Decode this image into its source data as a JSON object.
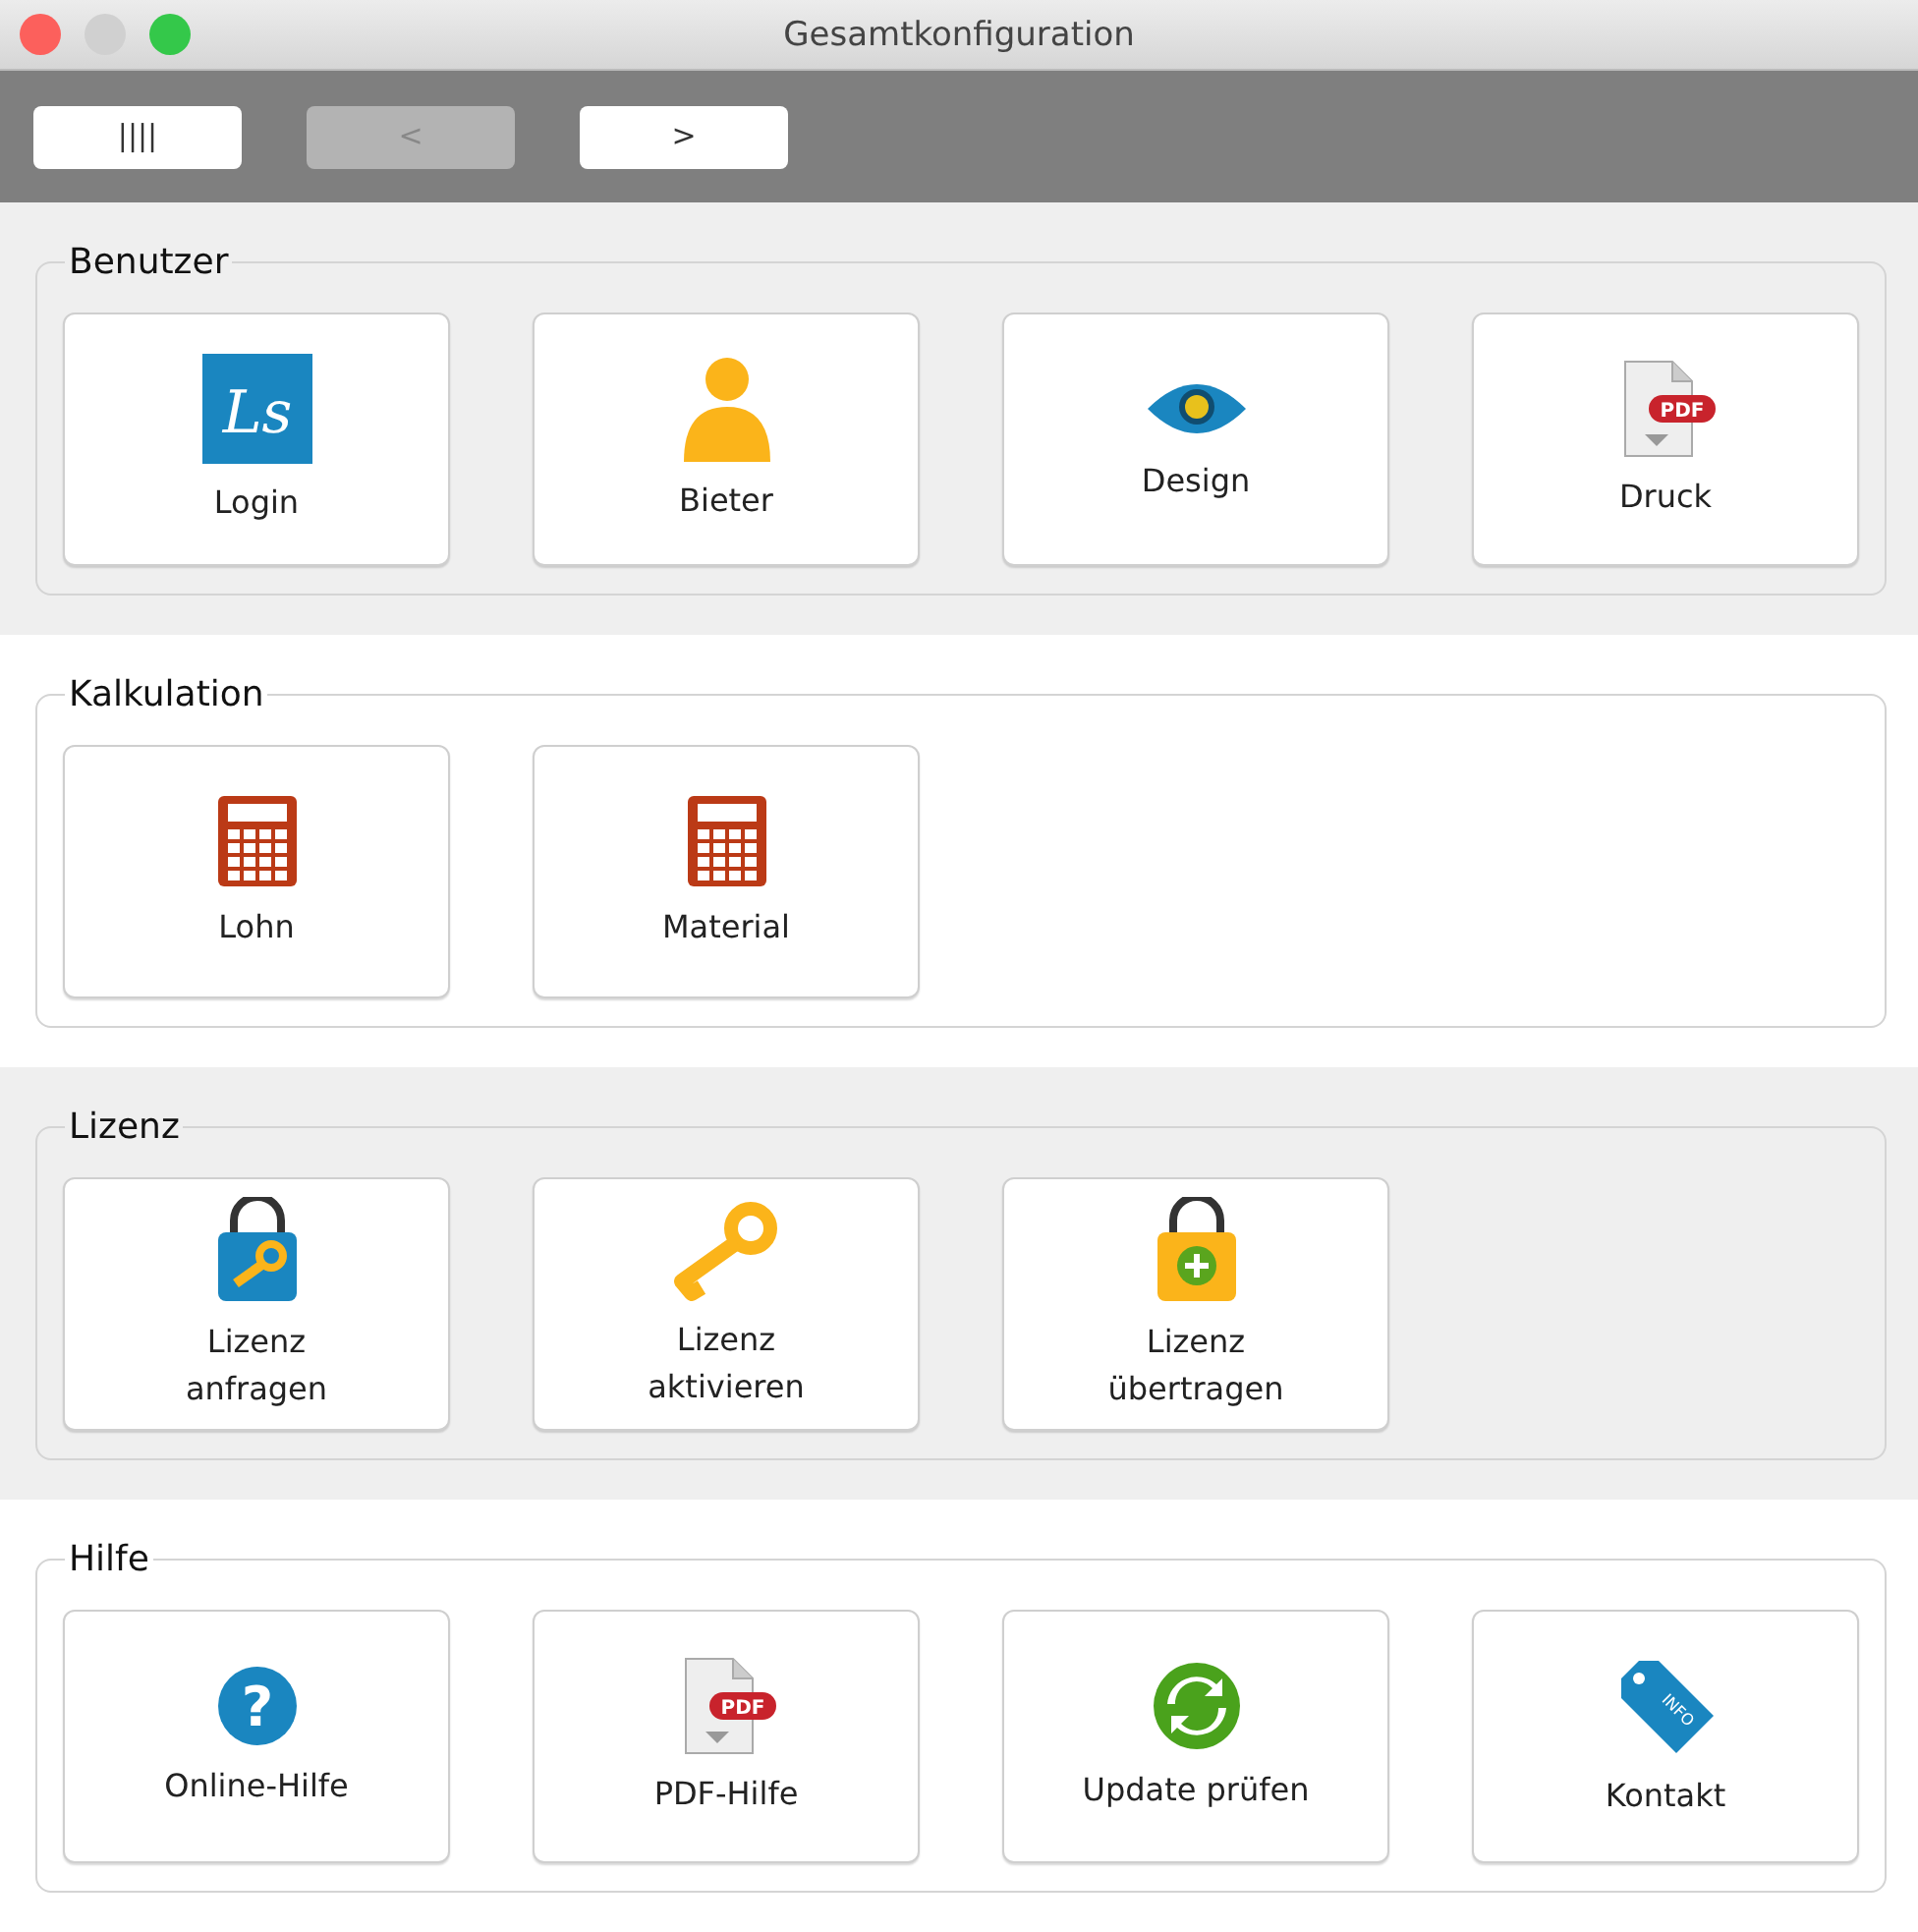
{
  "window": {
    "title": "Gesamtkonfiguration"
  },
  "toolbar": [
    {
      "label": "||||",
      "disabled": false
    },
    {
      "label": "<",
      "disabled": true
    },
    {
      "label": ">",
      "disabled": false
    }
  ],
  "sections": [
    {
      "title": "Benutzer",
      "shaded": true,
      "buttons": [
        {
          "label": "Login",
          "kind": "logo",
          "icon_text": "Ls"
        },
        {
          "label": "Bieter",
          "kind": "person"
        },
        {
          "label": "Design",
          "kind": "eye"
        },
        {
          "label": "Druck",
          "kind": "pdf",
          "icon_text": "PDF"
        }
      ]
    },
    {
      "title": "Kalkulation",
      "shaded": false,
      "buttons": [
        {
          "label": "Lohn",
          "kind": "calculator"
        },
        {
          "label": "Material",
          "kind": "calculator"
        }
      ]
    },
    {
      "title": "Lizenz",
      "shaded": true,
      "buttons": [
        {
          "label": "Lizenz\nanfragen",
          "kind": "lockkey"
        },
        {
          "label": "Lizenz\naktivieren",
          "kind": "key"
        },
        {
          "label": "Lizenz\nübertragen",
          "kind": "lockplus"
        }
      ]
    },
    {
      "title": "Hilfe",
      "shaded": false,
      "buttons": [
        {
          "label": "Online-Hilfe",
          "kind": "help",
          "icon_text": "?"
        },
        {
          "label": "PDF-Hilfe",
          "kind": "pdf",
          "icon_text": "PDF"
        },
        {
          "label": "Update prüfen",
          "kind": "refresh"
        },
        {
          "label": "Kontakt",
          "kind": "tag",
          "icon_text": "INFO"
        }
      ]
    }
  ]
}
